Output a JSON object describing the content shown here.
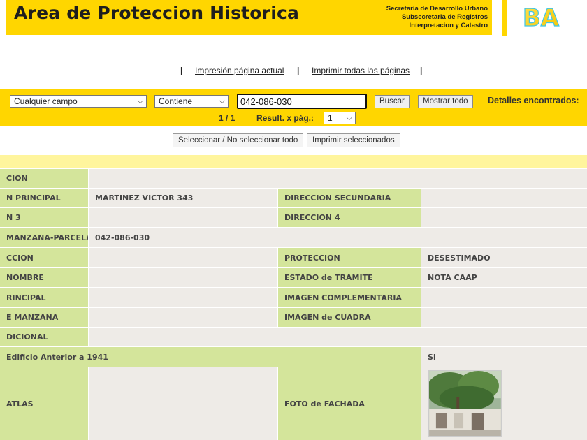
{
  "header": {
    "title": "Area de Proteccion Historica",
    "secretaria_lines": [
      "Secretaria de Desarrollo Urbano",
      "Subsecretaria de Registros",
      "Interpretacion y Catastro"
    ],
    "logo_text": "BA",
    "brand_color": "#ffd600"
  },
  "print_links": {
    "separator": "|",
    "current_page": "Impresión página actual",
    "all_pages": "Imprimir todas las páginas"
  },
  "search": {
    "field_select": "Cualquier campo",
    "operator_select": "Contiene",
    "query": "042-086-030",
    "search_button": "Buscar",
    "show_all_button": "Mostrar todo",
    "details_found": "Detalles encontrados:",
    "page_indicator": "1 / 1",
    "results_per_page_label": "Result. x pág.:",
    "results_per_page_value": "1"
  },
  "selection": {
    "select_toggle": "Seleccionar / No seleccionar todo",
    "print_selected": "Imprimir seleccionados"
  },
  "details": {
    "label_bg": "#d4e59b",
    "value_bg": "#eeebe7",
    "rows": [
      {
        "label": "CION",
        "value": ""
      },
      {
        "label": "N PRINCIPAL",
        "value": "MARTINEZ VICTOR 343",
        "label2": "DIRECCION SECUNDARIA",
        "value2": ""
      },
      {
        "label": "N 3",
        "value": "",
        "label2": "DIRECCION 4",
        "value2": ""
      },
      {
        "label": "MANZANA-PARCELA",
        "value": "042-086-030"
      },
      {
        "label": "CCION",
        "value": "",
        "label2": "PROTECCION",
        "value2": "DESESTIMADO"
      },
      {
        "label": "NOMBRE",
        "value": "",
        "label2": "ESTADO de TRAMITE",
        "value2": "NOTA CAAP"
      },
      {
        "label": "RINCIPAL",
        "value": "",
        "label2": "IMAGEN COMPLEMENTARIA",
        "value2": ""
      },
      {
        "label": "E MANZANA",
        "value": "",
        "label2": "IMAGEN de CUADRA",
        "value2": ""
      },
      {
        "label": "DICIONAL",
        "value": ""
      },
      {
        "label": "Edificio Anterior a 1941",
        "value": "SI"
      },
      {
        "label": "ATLAS",
        "value": "",
        "label2": "FOTO de FACHADA",
        "value2": ""
      }
    ]
  }
}
